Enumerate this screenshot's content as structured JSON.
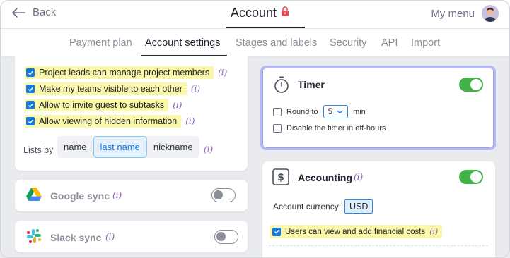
{
  "header": {
    "back_label": "Back",
    "title": "Account",
    "menu_label": "My menu"
  },
  "tabs": [
    {
      "label": "Payment plan",
      "active": false
    },
    {
      "label": "Account settings",
      "active": true
    },
    {
      "label": "Stages and labels",
      "active": false
    },
    {
      "label": "Security",
      "active": false
    },
    {
      "label": "API",
      "active": false
    },
    {
      "label": "Import",
      "active": false
    }
  ],
  "settings": {
    "options": [
      {
        "label": "Project leads can manage project members",
        "checked": true
      },
      {
        "label": "Make my teams visible to each other",
        "checked": true
      },
      {
        "label": "Allow to invite guest to subtasks",
        "checked": true
      },
      {
        "label": "Allow viewing of hidden information",
        "checked": true
      }
    ],
    "info_marker": "(i)",
    "lists_by_label": "Lists by",
    "lists_by_options": [
      "name",
      "last name",
      "nickname"
    ],
    "lists_by_selected": "last name"
  },
  "google_sync": {
    "title": "Google sync",
    "enabled": false
  },
  "slack_sync": {
    "title": "Slack sync",
    "enabled": false
  },
  "timer": {
    "title": "Timer",
    "enabled": true,
    "round_to_label": "Round to",
    "round_to_value": "5",
    "round_to_unit": "min",
    "round_to_checked": false,
    "off_hours_label": "Disable the timer in off-hours",
    "off_hours_checked": false
  },
  "accounting": {
    "title": "Accounting",
    "enabled": true,
    "currency_label": "Account currency:",
    "currency_value": "USD",
    "financial_costs_label": "Users can view and add financial costs",
    "financial_costs_checked": true
  },
  "colors": {
    "accent_blue": "#1677e6",
    "toggle_on": "#43b349",
    "highlight": "#fbf7a8",
    "info_purple": "#8c5cc2",
    "lock_red": "#e5484d",
    "selection_border": "#b6b9f3"
  }
}
